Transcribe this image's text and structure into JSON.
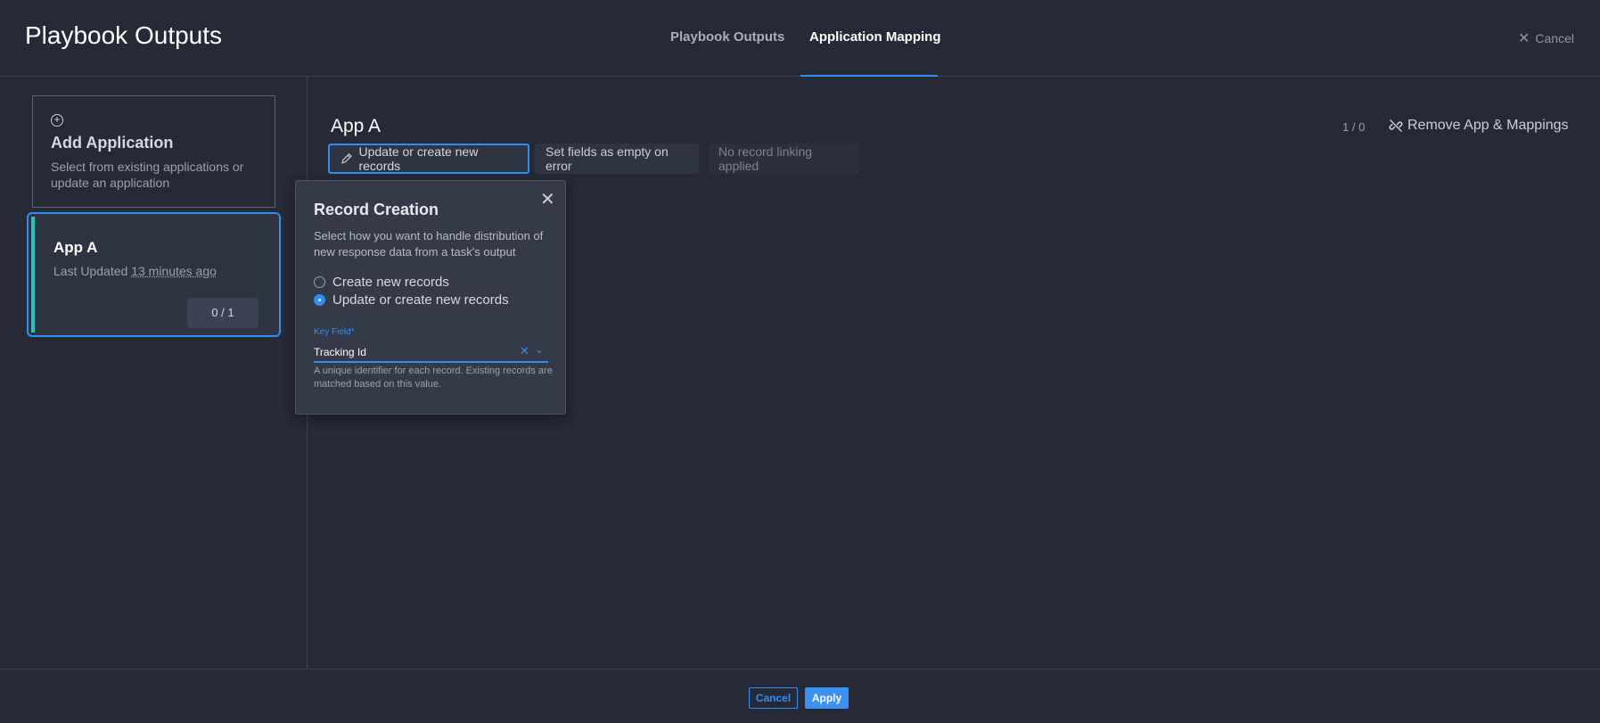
{
  "header": {
    "title": "Playbook Outputs",
    "tabs": [
      {
        "label": "Playbook Outputs",
        "active": false
      },
      {
        "label": "Application Mapping",
        "active": true
      }
    ],
    "cancel_label": "Cancel"
  },
  "sidebar": {
    "add_app": {
      "title": "Add Application",
      "description": "Select from existing applications or update an application"
    },
    "apps": [
      {
        "name": "App A",
        "updated_prefix": "Last Updated",
        "updated_ago": "13 minutes ago",
        "count": "0 / 1"
      }
    ]
  },
  "main": {
    "app_title": "App A",
    "count": "1 / 0",
    "remove_label": "Remove App & Mappings",
    "chips": {
      "update": "Update or create new records",
      "empty": "Set fields as empty on error",
      "linking": "No record linking applied"
    }
  },
  "popover": {
    "title": "Record Creation",
    "description": "Select how you want to handle distribution of new response data from a task's output",
    "options": [
      {
        "label": "Create new records",
        "checked": false
      },
      {
        "label": "Update or create new records",
        "checked": true
      }
    ],
    "key_field": {
      "label": "Key Field*",
      "value": "Tracking Id",
      "help": "A unique identifier for each record. Existing records are matched based on this value."
    }
  },
  "footer": {
    "cancel_label": "Cancel",
    "apply_label": "Apply"
  },
  "colors": {
    "accent": "#2f8ef4",
    "card_accent": "#1fc7b6",
    "background": "#252a36"
  }
}
